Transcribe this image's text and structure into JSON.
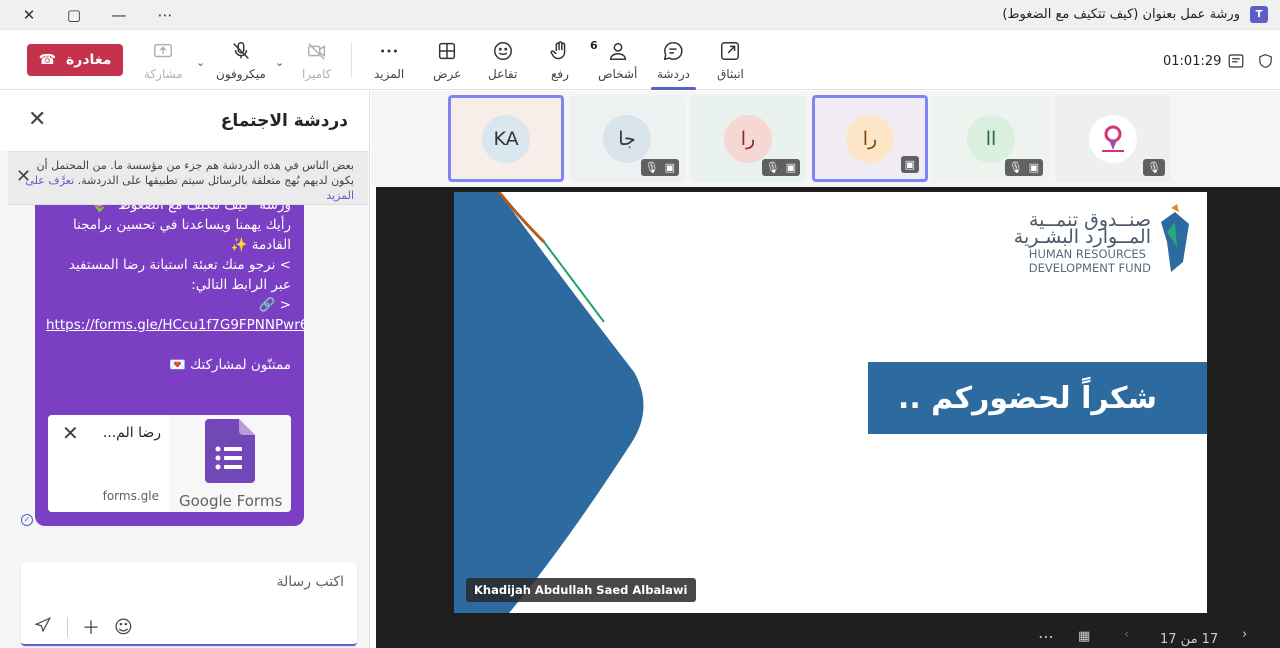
{
  "window": {
    "title": "ورشة عمل بعنوان (كيف تتكيف مع الضغوط)",
    "app_logo": "T"
  },
  "toolbar": {
    "leave_label": "مغادرة",
    "share_label": "مشاركة",
    "mic_label": "ميكروفون",
    "camera_label": "كاميرا",
    "more_label": "المزيد",
    "view_label": "عرض",
    "react_label": "تفاعل",
    "raise_label": "رفع",
    "people_label": "أشخاص",
    "people_count": "6",
    "chat_label": "دردشة",
    "popout_label": "انبثاق",
    "timer": "01:01:29"
  },
  "chat": {
    "title": "دردشة الاجتماع",
    "notice_text": "بعض الناس في هذه الدردشة هم جزء من مؤسسة ما. من المحتمل أن يكون لديهم نُهج متعلقة بالرسائل سيتم تطبيقها على الدردشة.",
    "notice_link": "تعرَّف على المزيد",
    "message": {
      "line1": "ورشة \"كيف تتكيف مع الضغوط\" 🌷",
      "line2": "رأيك يهمنا ويساعدنا في تحسين برامجنا القادمة ✨",
      "line3": "> نرجو منك تعبئة استبانة رضا المستفيد عبر الرابط التالي:",
      "line4": "< 🔗",
      "link": "https://forms.gle/HCcu1f7G9FPNNPwr6",
      "line5": "ممتنّون لمشاركتك 💌"
    },
    "card": {
      "title": "رضا الم...",
      "domain": "forms.gle",
      "brand": "Google Forms"
    },
    "compose_placeholder": "اكتب رسالة"
  },
  "participants": [
    {
      "initials": "KA",
      "bg": "#dbe7ee",
      "fg": "#333"
    },
    {
      "initials": "جا",
      "bg": "#d9e4ea",
      "fg": "#333"
    },
    {
      "initials": "را",
      "bg": "#f7d7d3",
      "fg": "#8a2b2b"
    },
    {
      "initials": "را",
      "bg": "#fde6c8",
      "fg": "#7a4a10"
    },
    {
      "initials": "اا",
      "bg": "#d9f0df",
      "fg": "#2a6a3a"
    }
  ],
  "slide": {
    "hrdf_ar_line1": "صنــدوق تنمــية",
    "hrdf_ar_line2": "المــوارد البشـرية",
    "hrdf_en_line1": "HUMAN RESOURCES",
    "hrdf_en_line2": "DEVELOPMENT FUND",
    "banner": "شكراً لحضوركم .."
  },
  "presenter_name": "Khadijah Abdullah Saed Albalawi",
  "pager": "17 من 17",
  "colors": {
    "accent": "#5b5fc7",
    "leave": "#c4314b",
    "bubble": "#7b3fc4",
    "slide_blue": "#2d6a9f"
  }
}
